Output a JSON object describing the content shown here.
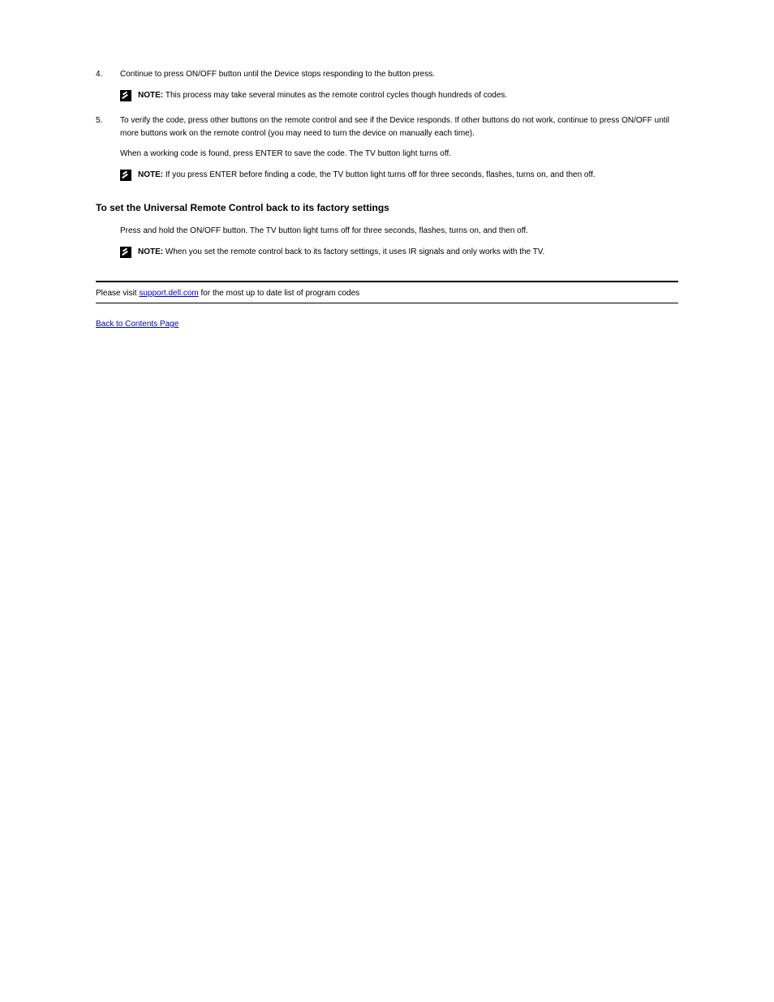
{
  "step4": {
    "num": "4.",
    "text": "Continue to press ON/OFF button until the Device stops responding to the button press. "
  },
  "note1": {
    "label": "NOTE: ",
    "text": "This process may take several minutes as the remote control cycles though hundreds of codes."
  },
  "step5": {
    "num": "5.",
    "text1": "To verify the code, press other buttons on the remote control and see if the Device responds.  If other buttons do not work, continue to press ON/OFF until more buttons work on the remote control (you may need to turn the device on manually each time).",
    "text2": "When a working code is found, press ENTER to save the code.  The TV button light turns off."
  },
  "note2": {
    "label": "NOTE: ",
    "text": "If you press ENTER before finding a code, the TV button light  turns off for three seconds, flashes, turns on, and then off."
  },
  "factory_heading": "To set the Universal Remote Control back to its factory settings",
  "factory_step": "Press and hold the ON/OFF button.  The TV button light turns off for three seconds, flashes, turns on, and then off.",
  "note3": {
    "label": "NOTE: ",
    "text": "When you set the remote control back to its factory settings, it uses IR signals and only works with the TV."
  },
  "help": {
    "prefix": "Please visit ",
    "link_text": "support.dell.com",
    "suffix": " for the most up to date list of program codes"
  },
  "back_link": "Back to Contents Page"
}
